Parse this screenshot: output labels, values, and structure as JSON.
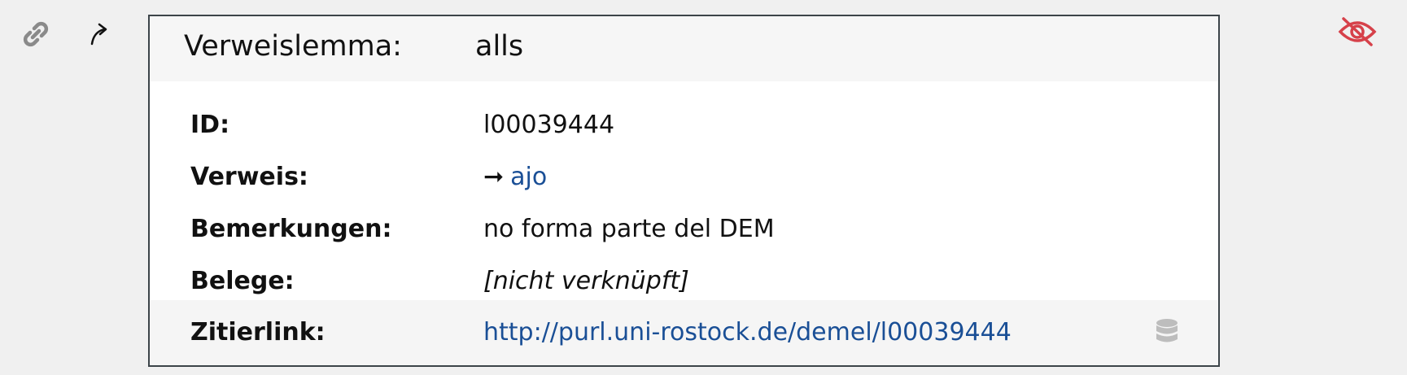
{
  "toolbar": {
    "link_icon": "link-icon",
    "return_icon": "return-arrow-icon",
    "hide_icon": "eye-slash-icon",
    "hide_color": "#d6414a"
  },
  "entry": {
    "head_label": "Verweislemma:",
    "head_value": "alls",
    "rows": [
      {
        "label": "ID:",
        "value": "l00039444"
      },
      {
        "label": "Verweis:",
        "arrow": "➞",
        "value": "ajo"
      },
      {
        "label": "Bemerkungen:",
        "value": "no forma parte del DEM"
      },
      {
        "label": "Belege:",
        "value": "[nicht verknüpft]"
      }
    ],
    "cite": {
      "label": "Zitierlink:",
      "value": "http://purl.uni-rostock.de/demel/l00039444",
      "icon": "database-icon"
    }
  },
  "colors": {
    "link": "#1a4f96",
    "border": "#3c4449"
  }
}
